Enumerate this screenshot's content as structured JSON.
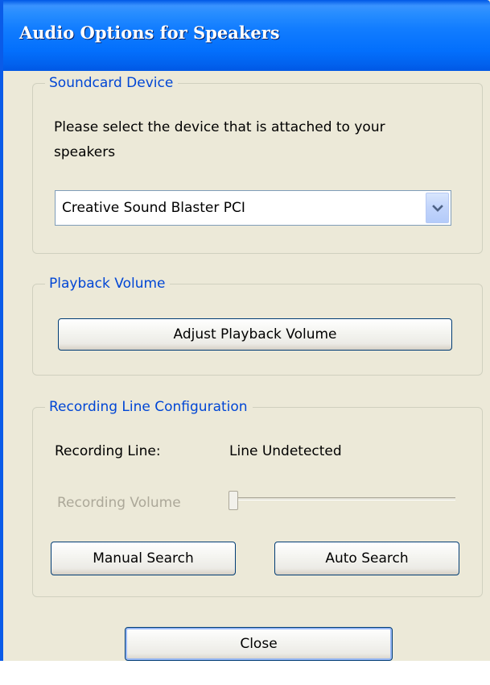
{
  "window": {
    "title": "Audio Options for Speakers"
  },
  "soundcard": {
    "legend": "Soundcard Device",
    "instruction_line1": "Please select the device that is attached to your",
    "instruction_line2": "speakers",
    "device_selected": "Creative Sound Blaster PCI"
  },
  "playback": {
    "legend": "Playback Volume",
    "adjust_button": "Adjust Playback Volume"
  },
  "recording": {
    "legend": "Recording Line Configuration",
    "line_label": "Recording Line:",
    "line_value": "Line Undetected",
    "volume_label": "Recording Volume",
    "volume_level": 0,
    "manual_button": "Manual Search",
    "auto_button": "Auto Search"
  },
  "footer": {
    "close_button": "Close"
  },
  "colors": {
    "accent_blue": "#0046D5",
    "title_bar": "#0058E6",
    "window_bg": "#ECE9D8",
    "disabled_text": "#ACA899"
  },
  "icons": {
    "dropdown": "chevron-down-icon"
  }
}
